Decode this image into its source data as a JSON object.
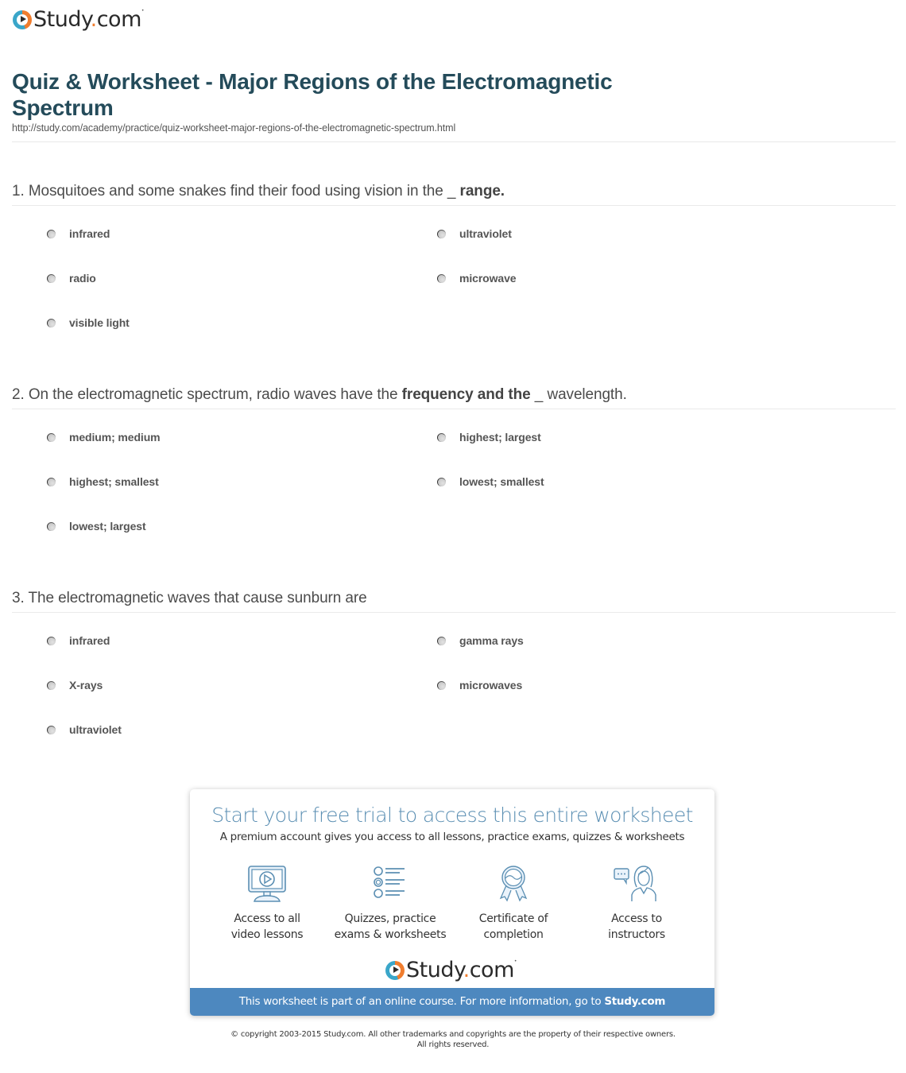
{
  "brand": {
    "name_prefix": "Study",
    "name_dot": ".",
    "name_suffix": "com",
    "colors": {
      "orange": "#f07d2e",
      "teal": "#3aa6c9",
      "title": "#244b5a",
      "promo_blue": "#4d88bf"
    }
  },
  "header": {
    "title": "Quiz & Worksheet - Major Regions of the Electromagnetic Spectrum",
    "url": "http://study.com/academy/practice/quiz-worksheet-major-regions-of-the-electromagnetic-spectrum.html"
  },
  "questions": [
    {
      "text_plain": "1. Mosquitoes and some snakes find their food using vision in the _ ",
      "text_bold": "range.",
      "text_after": "",
      "options": [
        "infrared",
        "ultraviolet",
        "radio",
        "microwave",
        "visible light"
      ]
    },
    {
      "text_plain": "2. On the electromagnetic spectrum, radio waves have the ",
      "text_bold": "frequency and the",
      "text_after": " _ wavelength.",
      "options": [
        "medium; medium",
        "highest; largest",
        "highest; smallest",
        "lowest; smallest",
        "lowest; largest"
      ]
    },
    {
      "text_plain": "3. The electromagnetic waves that cause sunburn are",
      "text_bold": "",
      "text_after": "",
      "options": [
        "infrared",
        "gamma rays",
        "X-rays",
        "microwaves",
        "ultraviolet"
      ]
    }
  ],
  "promo": {
    "title": "Start your free trial to access this entire worksheet",
    "subtitle": "A premium account gives you access to all lessons, practice exams, quizzes & worksheets",
    "features": [
      {
        "icon": "video-lesson-icon",
        "line1": "Access to all",
        "line2": "video lessons"
      },
      {
        "icon": "quiz-list-icon",
        "line1": "Quizzes, practice",
        "line2": "exams & worksheets"
      },
      {
        "icon": "certificate-icon",
        "line1": "Certificate of",
        "line2": "completion"
      },
      {
        "icon": "instructor-icon",
        "line1": "Access to",
        "line2": "instructors"
      }
    ],
    "bar_text": "This worksheet is part of an online course. For more information, go to ",
    "bar_link": "Study.com"
  },
  "footer": {
    "copyright_line1": "© copyright 2003-2015 Study.com. All other trademarks and copyrights are the property of their respective owners.",
    "copyright_line2": "All rights reserved."
  }
}
